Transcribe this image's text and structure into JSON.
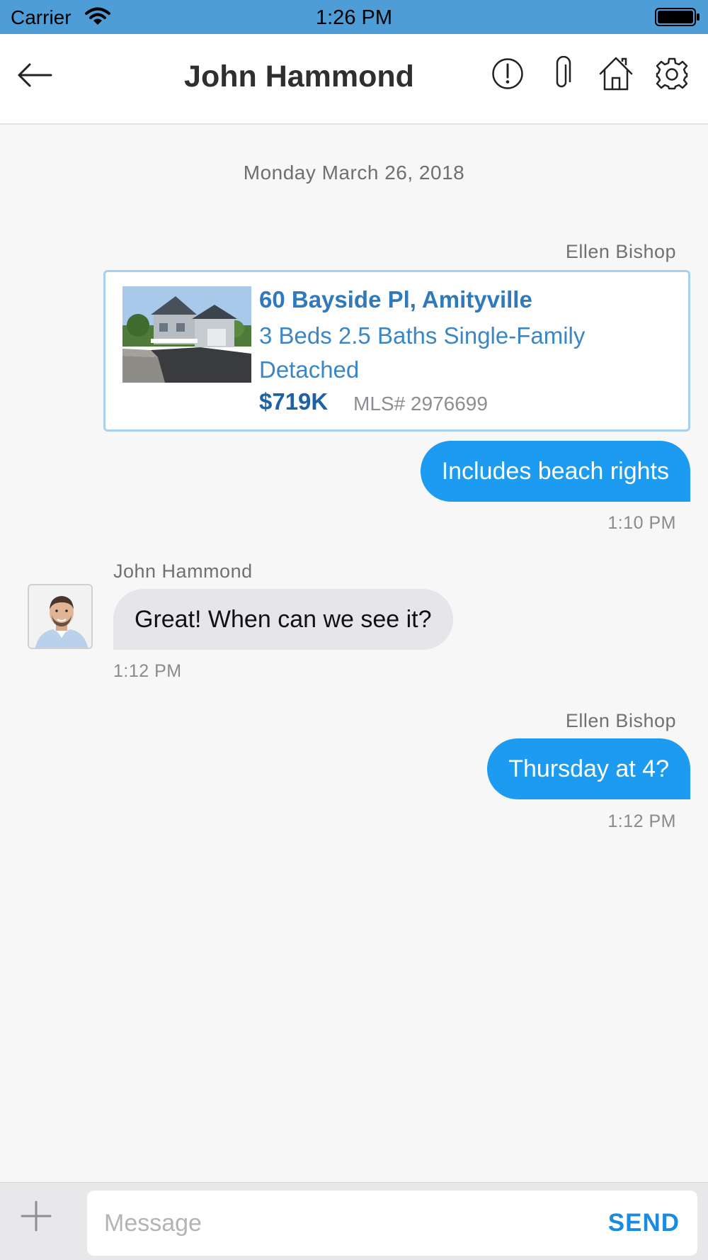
{
  "status_bar": {
    "carrier": "Carrier",
    "time": "1:26 PM"
  },
  "header": {
    "title": "John Hammond",
    "icons": [
      "back-arrow-icon",
      "alert-icon",
      "paperclip-icon",
      "home-icon",
      "gear-icon"
    ]
  },
  "conversation": {
    "date": "Monday March 26, 2018",
    "messages": [
      {
        "sender": "Ellen Bishop",
        "listing": {
          "address": "60 Bayside Pl, Amityville",
          "details": "3 Beds 2.5 Baths Single-Family Detached",
          "price": "$719K",
          "mls": "MLS# 2976699"
        },
        "text": "Includes beach rights",
        "time": "1:10 PM"
      },
      {
        "sender": "John Hammond",
        "text": "Great!  When can we see it?",
        "time": "1:12 PM"
      },
      {
        "sender": "Ellen Bishop",
        "text": "Thursday at 4?",
        "time": "1:12 PM"
      }
    ]
  },
  "composer": {
    "placeholder": "Message",
    "send_label": "SEND"
  },
  "colors": {
    "accent": "#1d9bf0",
    "status_bar": "#4f9dd6",
    "link": "#2f79bc"
  }
}
